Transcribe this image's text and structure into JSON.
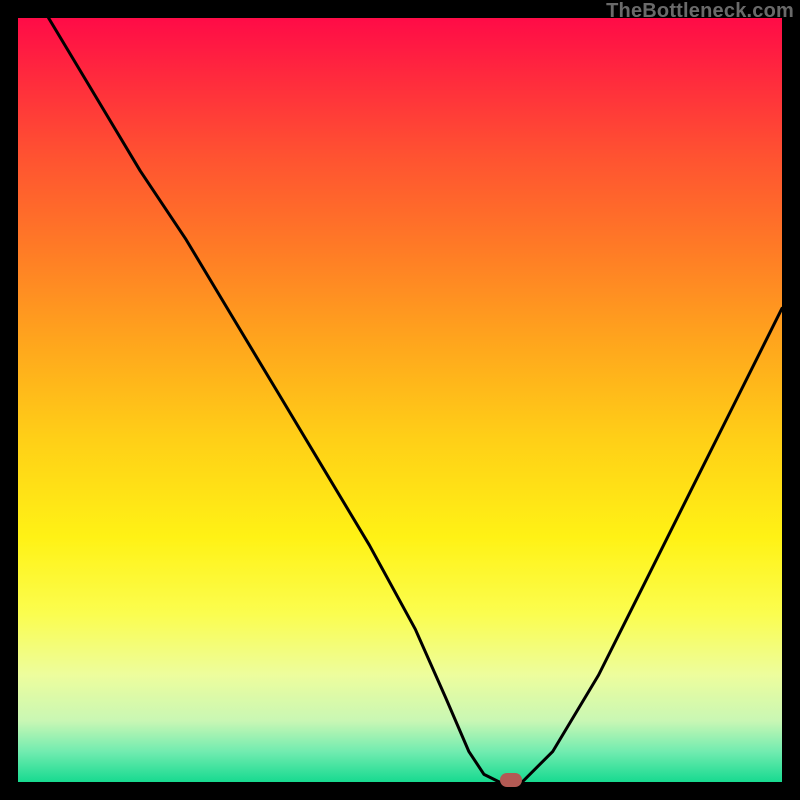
{
  "watermark": "TheBottleneck.com",
  "chart_data": {
    "type": "line",
    "title": "",
    "xlabel": "",
    "ylabel": "",
    "xlim": [
      0,
      100
    ],
    "ylim": [
      0,
      100
    ],
    "series": [
      {
        "name": "curve",
        "x": [
          4,
          10,
          16,
          22,
          28,
          34,
          40,
          46,
          52,
          56,
          59,
          61,
          63,
          66,
          70,
          76,
          82,
          88,
          94,
          100
        ],
        "y": [
          100,
          90,
          80,
          71,
          61,
          51,
          41,
          31,
          20,
          11,
          4,
          1,
          0,
          0,
          4,
          14,
          26,
          38,
          50,
          62
        ]
      }
    ],
    "marker": {
      "x": 64.5,
      "y": 0
    },
    "gradient_stops": [
      {
        "pos": 0,
        "color": "#ff0b47"
      },
      {
        "pos": 18,
        "color": "#ff5231"
      },
      {
        "pos": 42,
        "color": "#ffa41d"
      },
      {
        "pos": 68,
        "color": "#fff215"
      },
      {
        "pos": 92,
        "color": "#c9f7b4"
      },
      {
        "pos": 100,
        "color": "#17da90"
      }
    ]
  }
}
